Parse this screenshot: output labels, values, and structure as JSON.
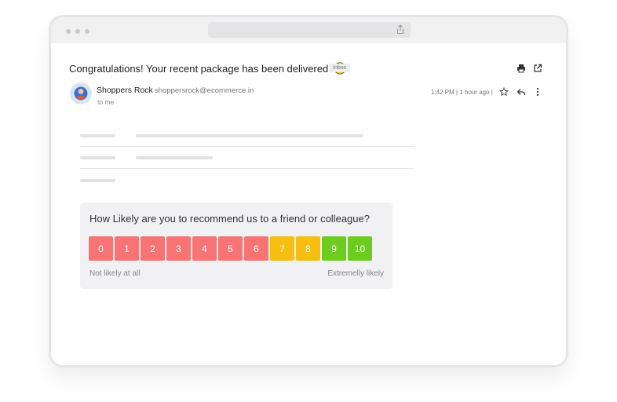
{
  "email": {
    "subject": "Congratulations! Your recent package has been delivered",
    "label_badge": "Inbox",
    "sender_name": "Shoppers Rock",
    "sender_email": "shoppersrock@ecommerce.in",
    "recipient": "to me",
    "timestamp": "1:42 PM | 1 hour ago |"
  },
  "survey": {
    "question": "How Likely are you to recommend us to a friend or colleague?",
    "scores": [
      {
        "label": "0",
        "color": "#f87373"
      },
      {
        "label": "1",
        "color": "#f87373"
      },
      {
        "label": "2",
        "color": "#f87373"
      },
      {
        "label": "3",
        "color": "#f87373"
      },
      {
        "label": "4",
        "color": "#f87373"
      },
      {
        "label": "5",
        "color": "#f87373"
      },
      {
        "label": "6",
        "color": "#f87373"
      },
      {
        "label": "7",
        "color": "#f7be12"
      },
      {
        "label": "8",
        "color": "#f7be12"
      },
      {
        "label": "9",
        "color": "#6ccd1f"
      },
      {
        "label": "10",
        "color": "#6ccd1f"
      }
    ],
    "low_label": "Not likely at all",
    "high_label": "Extremelly likely"
  },
  "icons": [
    "share-icon",
    "smiley-emoji-icon",
    "print-icon",
    "open-in-new-icon",
    "avatar-icon",
    "star-icon",
    "reply-icon",
    "more-vertical-icon"
  ]
}
